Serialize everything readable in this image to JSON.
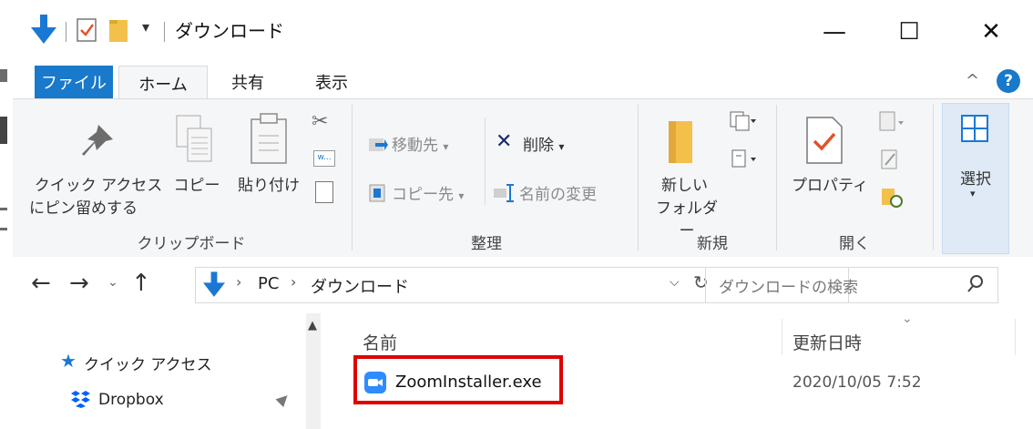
{
  "window": {
    "title": "ダウンロード",
    "controls": {
      "minimize": "—",
      "maximize": "☐",
      "close": "✕"
    }
  },
  "ribbon_tabs": {
    "file": "ファイル",
    "home": "ホーム",
    "share": "共有",
    "view": "表示"
  },
  "ribbon": {
    "clipboard": {
      "pin_line1": "クイック アクセス",
      "pin_line2": "にピン留めする",
      "copy": "コピー",
      "paste": "貼り付け",
      "group": "クリップボード"
    },
    "organize": {
      "move_to": "移動先",
      "delete": "削除",
      "copy_to": "コピー先",
      "rename": "名前の変更",
      "group": "整理"
    },
    "new": {
      "new_folder_line1": "新しい",
      "new_folder_line2": "フォルダー",
      "group": "新規"
    },
    "open": {
      "properties": "プロパティ",
      "group": "開く"
    },
    "select": {
      "select": "選択"
    }
  },
  "address": {
    "crumbs": [
      "PC",
      "ダウンロード"
    ],
    "search_placeholder": "ダウンロードの検索"
  },
  "nav_pane": {
    "quick_access": "クイック アクセス",
    "dropbox": "Dropbox"
  },
  "files": {
    "col_name": "名前",
    "col_modified": "更新日時",
    "rows": [
      {
        "name": "ZoomInstaller.exe",
        "modified": "2020/10/05 7:52"
      }
    ]
  },
  "colors": {
    "accent": "#1979ca",
    "highlight": "#e00000",
    "zoom": "#2d8cff"
  }
}
